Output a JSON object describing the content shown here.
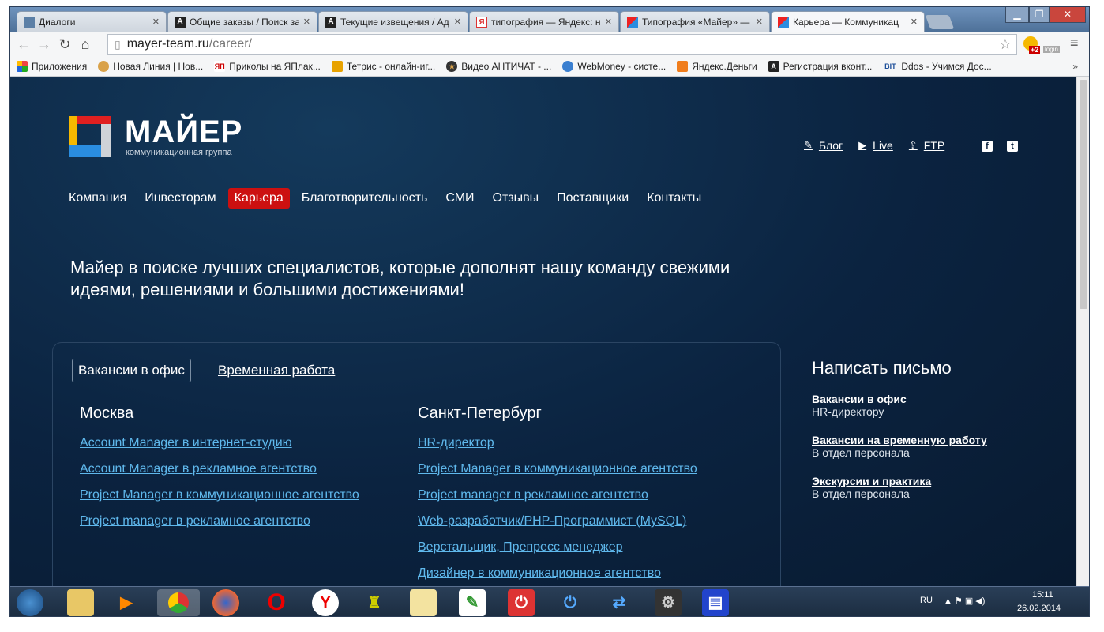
{
  "browser": {
    "tabs": [
      {
        "title": "Диалоги",
        "icon": "vk-icon",
        "color": "#5b7fa6"
      },
      {
        "title": "Общие заказы / Поиск за",
        "icon": "a-icon",
        "color": "#222"
      },
      {
        "title": "Текущие извещения / Ад",
        "icon": "a-icon",
        "color": "#222"
      },
      {
        "title": "типография — Яндекс: на",
        "icon": "yandex-icon",
        "color": "#d33"
      },
      {
        "title": "Типография «Майер» —",
        "icon": "mayer-icon",
        "color": "#d22"
      },
      {
        "title": "Карьера — Коммуникац",
        "icon": "mayer-icon",
        "color": "#d22"
      }
    ],
    "url_host": "mayer-team.ru",
    "url_path": "/career/",
    "ext_badge": "+2",
    "ext_login": "login",
    "bookmarks": [
      {
        "label": "Приложения",
        "color": "#e44"
      },
      {
        "label": "Новая Линия | Нов...",
        "color": "#d9a24a"
      },
      {
        "label": "Приколы на ЯПлак...",
        "color": "#c00"
      },
      {
        "label": "Тетрис - онлайн-иг...",
        "color": "#e8a200"
      },
      {
        "label": "Видео АНТИЧАТ - ...",
        "color": "#333"
      },
      {
        "label": "WebMoney - систе...",
        "color": "#3a7fd0"
      },
      {
        "label": "Яндекс.Деньги",
        "color": "#f07d1c"
      },
      {
        "label": "Регистрация вконт...",
        "color": "#222"
      },
      {
        "label": "Ddos - Учимся Дос...",
        "color": "#1d4f9a"
      }
    ],
    "more": "»"
  },
  "site": {
    "brand": "МАЙЕР",
    "tagline": "коммуникационная группа",
    "util": [
      {
        "label": "Блог",
        "icon": "pencil-icon"
      },
      {
        "label": "Live",
        "icon": "play-icon"
      },
      {
        "label": "FTP",
        "icon": "upload-icon"
      }
    ],
    "social": [
      "f",
      "t"
    ],
    "nav": [
      "Компания",
      "Инвесторам",
      "Карьера",
      "Благотворительность",
      "СМИ",
      "Отзывы",
      "Поставщики",
      "Контакты"
    ],
    "intro": "Майер в поиске лучших специалистов, которые дополнят нашу команду свежими идеями, решениями и большими достижениями!",
    "tabs": [
      "Вакансии в офис",
      "Временная работа"
    ],
    "moscow": {
      "city": "Москва",
      "jobs": [
        "Account Manager в интернет-студию",
        "Account Manager в рекламное агентство",
        "Project Manager в коммуникационное агентство",
        "Project manager в рекламное агентство"
      ]
    },
    "spb": {
      "city": "Санкт-Петербург",
      "jobs": [
        "HR-директор",
        "Project Manager в коммуникационное агентство",
        "Project manager в рекламное агентство",
        "Web-разработчик/PHP-Программист (MySQL)",
        "Верстальщик, Препресс менеджер",
        "Дизайнер в коммуникационное агентство"
      ]
    },
    "sidebar": {
      "title": "Написать письмо",
      "items": [
        {
          "link": "Вакансии в офис",
          "sub": "HR-директору"
        },
        {
          "link": "Вакансии на временную работу",
          "sub": "В отдел персонала"
        },
        {
          "link": "Экскурсии и практика",
          "sub": "В отдел персонала"
        }
      ]
    }
  },
  "taskbar": {
    "lang": "RU",
    "time": "15:11",
    "date": "26.02.2014"
  }
}
